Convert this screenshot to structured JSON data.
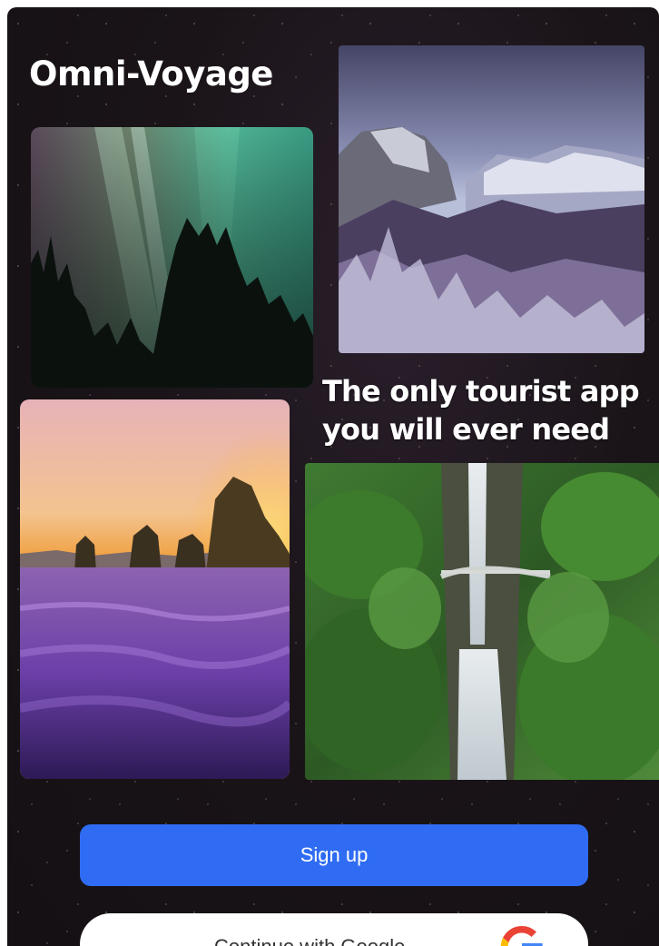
{
  "app": {
    "title": "Omni-Voyage",
    "tagline": "The only tourist app you will ever need"
  },
  "gallery": [
    {
      "name": "aurora-forest",
      "icon": "aurora-photo"
    },
    {
      "name": "yosemite-valley",
      "icon": "snowy-valley-photo"
    },
    {
      "name": "lavender-field",
      "icon": "lavender-sunset-photo"
    },
    {
      "name": "multnomah-falls",
      "icon": "waterfall-photo"
    }
  ],
  "actions": {
    "signup_label": "Sign up",
    "google_label": "Continue with Google",
    "google_icon": "google-g-icon"
  },
  "colors": {
    "accent": "#2f6cf3",
    "background": "#1a1418",
    "text": "#ffffff"
  }
}
